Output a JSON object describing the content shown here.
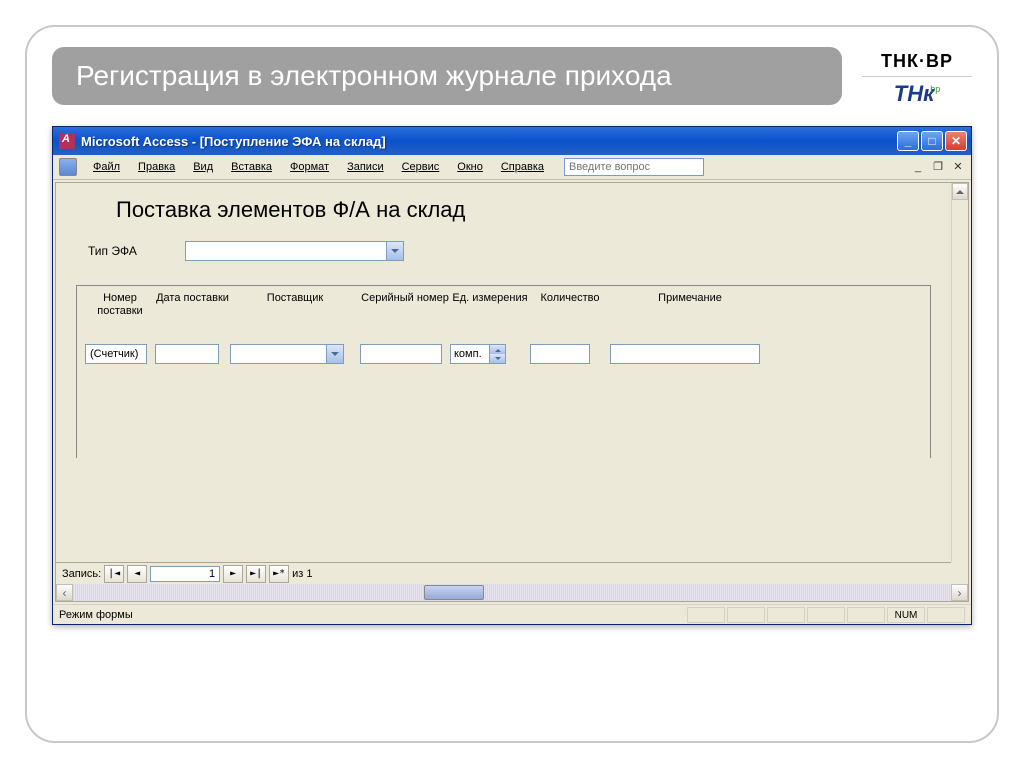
{
  "slide": {
    "title": "Регистрация в электронном журнале прихода",
    "logo_top": "ТНК·BP",
    "logo_tnk": "ТНк",
    "logo_bp": "bp"
  },
  "window": {
    "title": "Microsoft Access - [Поступление ЭФА на склад]"
  },
  "menu": {
    "file": "Файл",
    "edit": "Правка",
    "view": "Вид",
    "insert": "Вставка",
    "format": "Формат",
    "records": "Записи",
    "service": "Сервис",
    "window": "Окно",
    "help": "Справка",
    "help_placeholder": "Введите вопрос"
  },
  "form": {
    "heading": "Поставка элементов Ф/А на склад",
    "type_label": "Тип ЭФА",
    "type_value": "",
    "columns": {
      "c1": "Номер поставки",
      "c2": "Дата поставки",
      "c3": "Поставщик",
      "c4": "Серийный номер",
      "c5": "Ед. измерения",
      "c6": "Количество",
      "c7": "Примечание"
    },
    "row": {
      "delivery_no": "(Счетчик)",
      "delivery_date": "",
      "supplier": "",
      "serial": "",
      "unit": "комп.",
      "qty": "",
      "note": ""
    }
  },
  "recordnav": {
    "label": "Запись:",
    "current": "1",
    "of_label": "из",
    "total": "1"
  },
  "status": {
    "mode": "Режим формы",
    "num": "NUM"
  }
}
